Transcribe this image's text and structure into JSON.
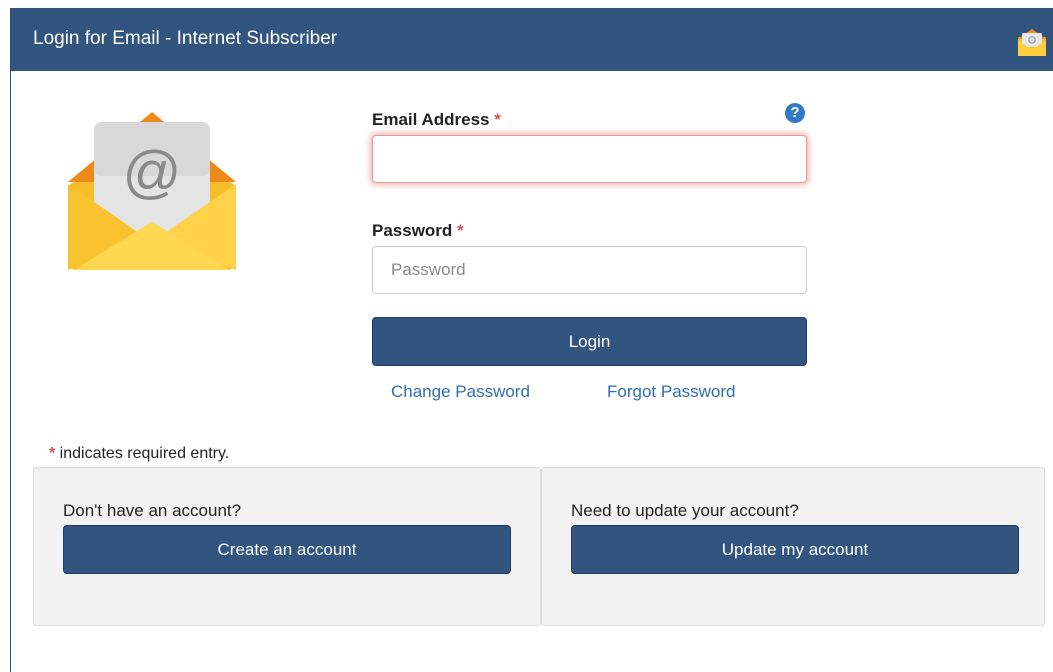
{
  "header": {
    "title": "Login for Email - Internet Subscriber",
    "icon": "email-icon"
  },
  "login": {
    "email_label": "Email Address",
    "email_value": "",
    "email_placeholder": "",
    "password_label": "Password",
    "password_value": "",
    "password_placeholder": "Password",
    "required_marker": "*",
    "help_icon": "question-icon",
    "help_glyph": "?",
    "login_button": "Login",
    "change_password_link": "Change Password",
    "forgot_password_link": "Forgot Password"
  },
  "required_note": {
    "marker": "*",
    "text": " indicates required entry."
  },
  "panels": {
    "create": {
      "prompt": "Don't have an account?",
      "button": "Create an account"
    },
    "update": {
      "prompt": "Need to update your account?",
      "button": "Update my account"
    }
  },
  "colors": {
    "header_bg": "#325580",
    "button_bg": "#325580",
    "link": "#2f6fb5",
    "required": "#d9534f",
    "envelope_yellow": "#f7be2b",
    "envelope_orange": "#ec8a1c"
  }
}
